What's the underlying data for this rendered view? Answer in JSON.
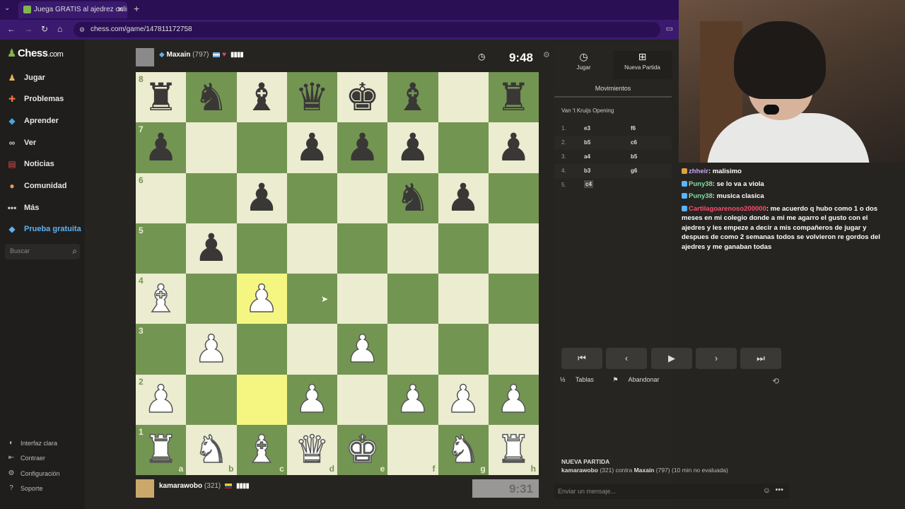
{
  "browser": {
    "tab_title": "Juega GRATIS al ajedrez online",
    "url": "chess.com/game/147811172758"
  },
  "sidebar": {
    "logo": "Chess",
    "logo_suffix": ".com",
    "items": [
      {
        "label": "Jugar",
        "icon": "play-icon"
      },
      {
        "label": "Problemas",
        "icon": "puzzle-icon"
      },
      {
        "label": "Aprender",
        "icon": "learn-icon"
      },
      {
        "label": "Ver",
        "icon": "binoculars-icon"
      },
      {
        "label": "Noticias",
        "icon": "news-icon"
      },
      {
        "label": "Comunidad",
        "icon": "community-icon"
      },
      {
        "label": "Más",
        "icon": "more-icon"
      },
      {
        "label": "Prueba gratuita",
        "icon": "diamond-icon"
      }
    ],
    "search_placeholder": "Buscar",
    "bottom": [
      {
        "label": "Interfaz clara"
      },
      {
        "label": "Contraer"
      },
      {
        "label": "Configuración"
      },
      {
        "label": "Soporte"
      }
    ]
  },
  "top_player": {
    "name": "Maxain",
    "rating": "(797)",
    "clock": "9:48"
  },
  "bottom_player": {
    "name": "kamarawobo",
    "rating": "(321)",
    "clock": "9:31"
  },
  "board": {
    "rows": [
      [
        "bR",
        "bN",
        "bB",
        "bQ",
        "bK",
        "bB",
        "",
        "bR"
      ],
      [
        "bP",
        "",
        "",
        "bP",
        "bP",
        "bP",
        "",
        "bP"
      ],
      [
        "",
        "",
        "bP",
        "",
        "",
        "bN",
        "bP",
        ""
      ],
      [
        "",
        "bP",
        "",
        "",
        "",
        "",
        "",
        ""
      ],
      [
        "wB",
        "",
        "wP",
        "",
        "",
        "",
        "",
        ""
      ],
      [
        "",
        "wP",
        "",
        "",
        "wP",
        "",
        "",
        ""
      ],
      [
        "wP",
        "",
        "",
        "wP",
        "",
        "wP",
        "wP",
        "wP"
      ],
      [
        "wR",
        "wN",
        "wB",
        "wQ",
        "wK",
        "",
        "wN",
        "wR"
      ]
    ],
    "highlight": [
      "c4",
      "c2"
    ],
    "ranks": [
      "8",
      "7",
      "6",
      "5",
      "4",
      "3",
      "2",
      "1"
    ],
    "files": [
      "a",
      "b",
      "c",
      "d",
      "e",
      "f",
      "g",
      "h"
    ]
  },
  "panel": {
    "tab_play": "Jugar",
    "tab_new": "Nueva Partida",
    "title": "Movimientos",
    "opening": "Van 't Kruijs Opening",
    "moves": [
      {
        "num": "1.",
        "white": "e3",
        "black": "f6"
      },
      {
        "num": "2.",
        "white": "b5",
        "black": "c6"
      },
      {
        "num": "3.",
        "white": "a4",
        "black": "b5"
      },
      {
        "num": "4.",
        "white": "b3",
        "black": "g6"
      },
      {
        "num": "5.",
        "white": "c4",
        "black": ""
      }
    ],
    "draw": "Tablas",
    "resign": "Abandonar",
    "new_game_title": "NUEVA PARTIDA",
    "new_game_white": "kamarawobo",
    "new_game_white_rating": "(321)",
    "new_game_vs": "contra",
    "new_game_black": "Maxain",
    "new_game_black_rating": "(797)",
    "new_game_mode": "(10 min no evaluada)",
    "message_placeholder": "Enviar un mensaje..."
  },
  "chat": [
    {
      "user": "zhheir",
      "text": "malisimo",
      "color": "purple"
    },
    {
      "user": "Puny38",
      "text": "se lo va a viola",
      "color": "green"
    },
    {
      "user": "Puny38",
      "text": "musica clasica",
      "color": "green"
    },
    {
      "user": "Cartilagoarenoso200000",
      "text": "me acuerdo q hubo como 1 o dos meses en mi colegio donde a mi me agarro el gusto con el ajedres y les empeze a decir a mis compañeros de jugar y despues de como 2 semanas todos se volvieron re gordos del ajedres y me ganaban todas",
      "color": "red"
    }
  ]
}
